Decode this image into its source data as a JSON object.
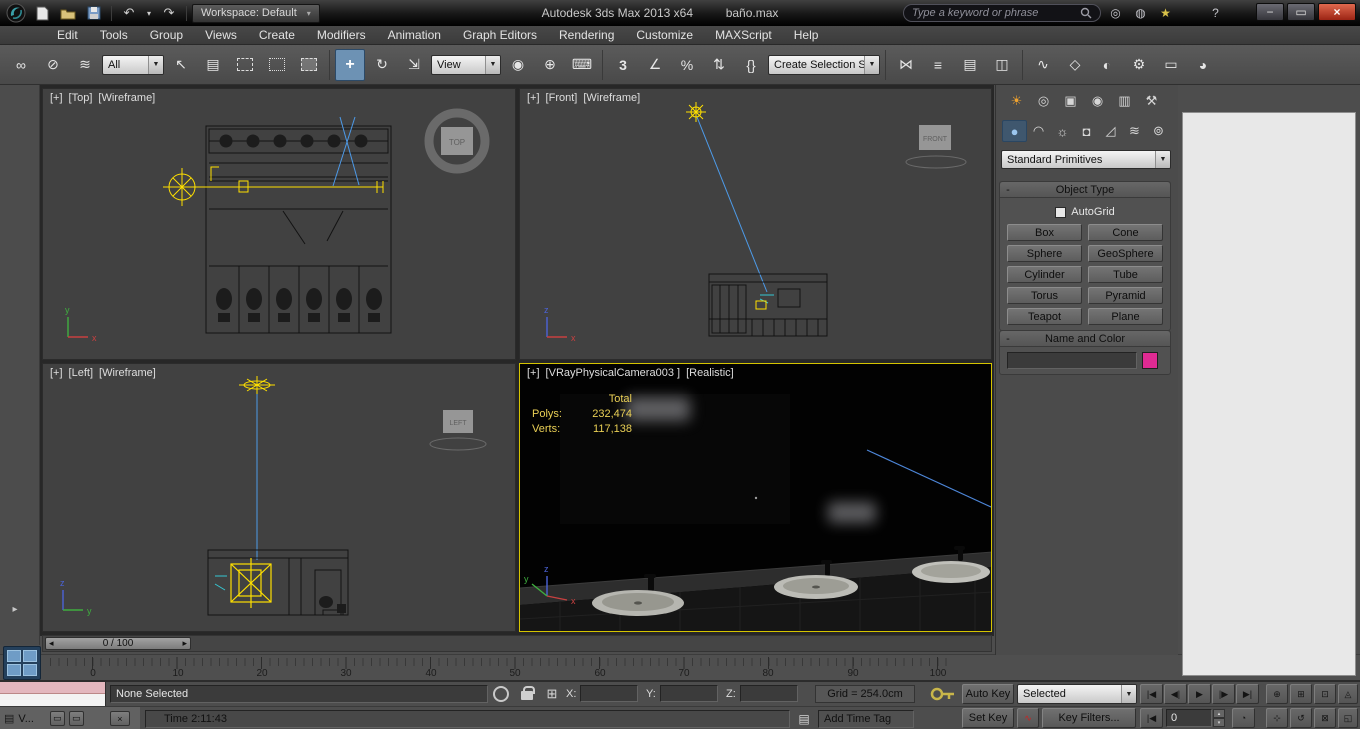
{
  "colors": {
    "active_viewport_border": "#d5c400",
    "selection_yellow": "#ffe000",
    "view_ray_blue": "#4d9ae8",
    "swatch_pink": "#df2a92",
    "close_button_red": "#b2301c",
    "stats_yellow": "#e9cf55"
  },
  "titlebar": {
    "workspace": "Workspace: Default",
    "app_title": "Autodesk 3ds Max  2013 x64",
    "file_name": "baño.max",
    "search_placeholder": "Type a keyword or phrase"
  },
  "menubar": {
    "items": [
      "Edit",
      "Tools",
      "Group",
      "Views",
      "Create",
      "Modifiers",
      "Animation",
      "Graph Editors",
      "Rendering",
      "Customize",
      "MAXScript",
      "Help"
    ]
  },
  "toolbar": {
    "filter_dropdown": "All",
    "coord_system_dropdown": "View",
    "named_selection_dropdown": "Create Selection Se"
  },
  "viewports": {
    "top": {
      "menu": "[+]",
      "view": "[Top]",
      "shading": "[Wireframe]",
      "gizmo": "TOP"
    },
    "front": {
      "menu": "[+]",
      "view": "[Front]",
      "shading": "[Wireframe]",
      "gizmo": "FRONT"
    },
    "left": {
      "menu": "[+]",
      "view": "[Left]",
      "shading": "[Wireframe]",
      "gizmo": "LEFT"
    },
    "camera": {
      "menu": "[+]",
      "view": "[VRayPhysicalCamera003 ]",
      "shading": "[Realistic]",
      "stats": {
        "total": "Total",
        "polys_label": "Polys:",
        "polys_value": "232,474",
        "verts_label": "Verts:",
        "verts_value": "117,138"
      }
    },
    "axes": {
      "x": "x",
      "y": "y",
      "z": "z"
    }
  },
  "command_panel": {
    "category_dropdown": "Standard Primitives",
    "object_type": {
      "title": "Object Type",
      "autogrid": "AutoGrid",
      "buttons": [
        "Box",
        "Cone",
        "Sphere",
        "GeoSphere",
        "Cylinder",
        "Tube",
        "Torus",
        "Pyramid",
        "Teapot",
        "Plane"
      ]
    },
    "name_and_color": {
      "title": "Name and Color"
    }
  },
  "timeline": {
    "slider": "0 / 100",
    "ticks": [
      "0",
      "10",
      "20",
      "30",
      "40",
      "50",
      "60",
      "70",
      "80",
      "90",
      "100"
    ]
  },
  "statusbar": {
    "prompt": "None Selected",
    "x_label": "X:",
    "y_label": "Y:",
    "z_label": "Z:",
    "grid": "Grid = 254.0cm",
    "status_line": "Time  2:11:43",
    "add_time_tag": "Add Time Tag",
    "auto_key": "Auto Key",
    "set_key": "Set Key",
    "key_mode_dropdown": "Selected",
    "key_filters": "Key Filters...",
    "frame_field": "0",
    "listener_tab": "V..."
  },
  "icons": {
    "undo": "↶",
    "redo": "↷",
    "caret": "▾",
    "combo_arrow": "▼",
    "comm_center": "◎",
    "favorites": "★",
    "signin": "◍",
    "help": "?",
    "minimize": "−",
    "maximize": "▭",
    "close": "×",
    "link": "∞",
    "unlink": "⊘",
    "bind": "≋",
    "select": "↖",
    "by_name": "▤",
    "move": "+",
    "rotate": "↻",
    "scale": "⇲",
    "pivot": "◉",
    "manipulate": "⊕",
    "keyboard": "⌨",
    "snap3": "3",
    "snap_angle": "∠",
    "snap_percent": "%",
    "snap_spinner": "⇅",
    "named_sets": "{}",
    "mirror": "⋈",
    "align": "≡",
    "layers": "▤",
    "ribbon": "◫",
    "curve_editor": "∿",
    "schematic": "◇",
    "material": "◐",
    "render_setup": "⚙",
    "rendered_frame": "▭",
    "render": "◕",
    "tab_create": "☀",
    "tab_modify": "◎",
    "tab_hierarchy": "▣",
    "tab_motion": "◉",
    "tab_display": "▥",
    "tab_utilities": "⚒",
    "cat_geometry": "●",
    "cat_shapes": "◠",
    "cat_lights": "☼",
    "cat_cameras": "◘",
    "cat_helpers": "◿",
    "cat_warps": "≋",
    "cat_systems": "⊚",
    "slider_left": "◂",
    "slider_right": "▸",
    "mini_curve": "∿",
    "ring": "○",
    "abs_offset": "⊞",
    "page": "▤",
    "play_start": "|◀",
    "play_prev": "◀|",
    "play": "▶",
    "play_next": "|▶",
    "play_end": "▶|",
    "key_mode": "|◀",
    "frame_up": "▴",
    "frame_down": "▾",
    "time_config": "◔",
    "set_key_curve": "∿",
    "nav_zoom": "⊕",
    "nav_zoom_all": "⊞",
    "nav_zoom_extents": "⊡",
    "nav_fov": "◬",
    "nav_pan": "⊹",
    "nav_orbit": "↺",
    "nav_maximize": "◱",
    "nav_zoom_region": "⊠",
    "expand_arrow": "▸"
  }
}
